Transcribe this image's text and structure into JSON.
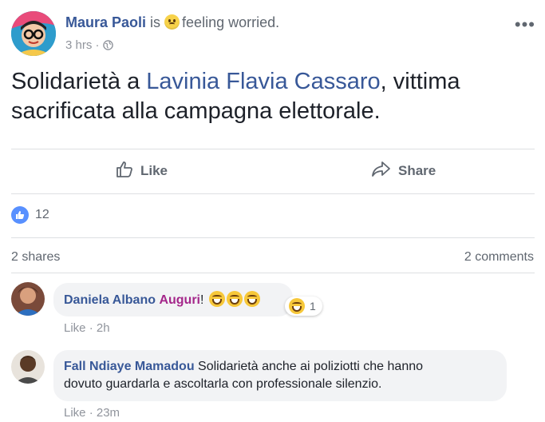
{
  "post": {
    "author": "Maura Paoli",
    "is_text": "is",
    "feeling_text": "feeling worried.",
    "feeling_icon": "worried-emoji-icon",
    "time": "3 hrs",
    "separator": "·",
    "privacy_icon": "globe-icon",
    "more_icon": "•••",
    "text_before": "Solidarietà a ",
    "text_link": "Lavinia Flavia Cassaro",
    "text_after": ", vittima sacrificata alla campagna elettorale."
  },
  "actions": {
    "like_label": "Like",
    "share_label": "Share"
  },
  "stats": {
    "reactions_count": "12",
    "shares": "2 shares",
    "comments": "2 comments"
  },
  "comments": [
    {
      "author": "Daniela Albano",
      "mention": "Auguri",
      "punct": "!",
      "reaction_count": "1",
      "like_label": "Like",
      "separator": "·",
      "time": "2h"
    },
    {
      "author": "Fall Ndiaye Mamadou",
      "text_line1": "Solidarietà anche ai poliziotti che hanno",
      "text_line2": "dovuto guardarla e ascoltarla con professionale silenzio.",
      "like_label": "Like",
      "separator": "·",
      "time": "23m"
    }
  ],
  "colors": {
    "link": "#385898",
    "meta": "#90949c",
    "mention": "#a4268a",
    "like_blue": "#5890ff",
    "bubble_bg": "#f2f3f5"
  }
}
